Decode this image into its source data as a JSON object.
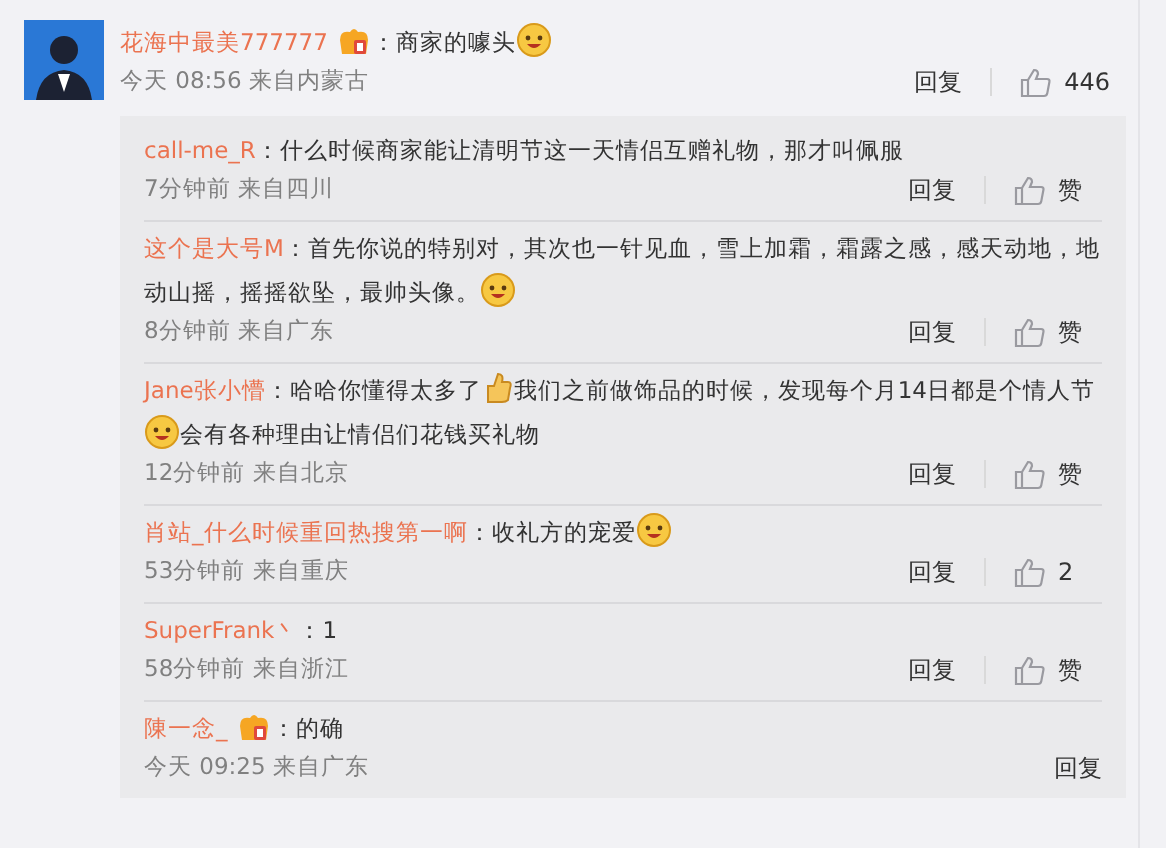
{
  "comment": {
    "author": "花海中最美777777",
    "badge": true,
    "parts": [
      {
        "kind": "text",
        "text": "：商家的噱头"
      },
      {
        "kind": "emoji"
      }
    ],
    "time": "今天 08:56",
    "source": "来自内蒙古",
    "reply": "回复",
    "likes": "446"
  },
  "replies": [
    {
      "author": "call-me_R",
      "badge": false,
      "parts": [
        {
          "kind": "text",
          "text": "：什么时候商家能让清明节这一天情侣互赠礼物，那才叫佩服"
        }
      ],
      "time": "7分钟前",
      "source": "来自四川",
      "reply": "回复",
      "likes": "赞"
    },
    {
      "author": "这个是大号M",
      "badge": false,
      "parts": [
        {
          "kind": "text",
          "text": "：首先你说的特别对，其次也一针见血，雪上加霜，霜露之感，感天动地，地动山摇，摇摇欲坠，最帅头像。"
        },
        {
          "kind": "emoji"
        }
      ],
      "time": "8分钟前",
      "source": "来自广东",
      "reply": "回复",
      "likes": "赞"
    },
    {
      "author": "Jane张小懵",
      "badge": false,
      "parts": [
        {
          "kind": "text",
          "text": "：哈哈你懂得太多了"
        },
        {
          "kind": "thumb"
        },
        {
          "kind": "text",
          "text": "我们之前做饰品的时候，发现每个月14日都是个情人节"
        },
        {
          "kind": "emoji"
        },
        {
          "kind": "text",
          "text": "会有各种理由让情侣们花钱买礼物"
        }
      ],
      "time": "12分钟前",
      "source": "来自北京",
      "reply": "回复",
      "likes": "赞"
    },
    {
      "author": "肖站_什么时候重回热搜第一啊",
      "badge": false,
      "parts": [
        {
          "kind": "text",
          "text": "：收礼方的宠爱"
        },
        {
          "kind": "emoji"
        }
      ],
      "time": "53分钟前",
      "source": "来自重庆",
      "reply": "回复",
      "likes": "2"
    },
    {
      "author": "SuperFrank丶",
      "badge": false,
      "parts": [
        {
          "kind": "text",
          "text": "：1"
        }
      ],
      "time": "58分钟前",
      "source": "来自浙江",
      "reply": "回复",
      "likes": "赞"
    },
    {
      "author": "陳一念_",
      "badge": true,
      "parts": [
        {
          "kind": "text",
          "text": "：的确"
        }
      ],
      "time": "今天 09:25",
      "source": "来自广东",
      "reply": "回复"
    }
  ]
}
